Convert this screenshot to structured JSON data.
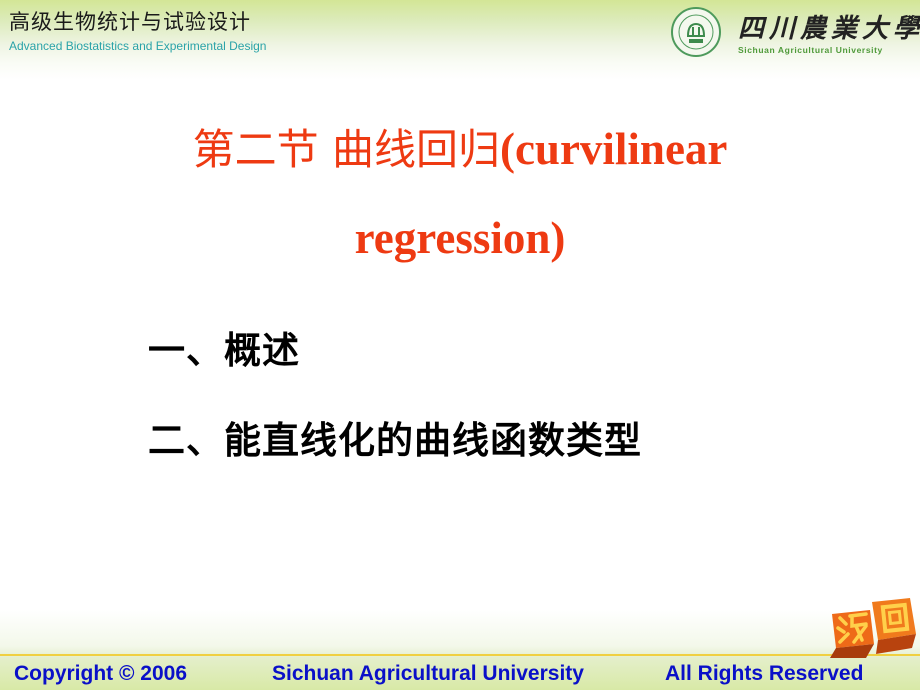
{
  "header": {
    "course_title_cn": "高级生物统计与试验设计",
    "course_title_en": "Advanced Biostatistics and Experimental Design",
    "logo": {
      "seal_icon": "university-seal-icon",
      "name_cn": "四川農業大學",
      "name_en": "Sichuan Agricultural University"
    }
  },
  "slide": {
    "title_cn": "第二节  曲线回归",
    "title_en_line1": "(curvilinear",
    "title_en_line2": "regression)",
    "outline": [
      {
        "label": "一、概述"
      },
      {
        "label": "二、能直线化的曲线函数类型"
      }
    ]
  },
  "nav": {
    "return_label": "返回",
    "return_icon": "return-3d-block-icon"
  },
  "footer": {
    "copyright": "Copyright © 2006",
    "university": "Sichuan Agricultural University",
    "rights": "All Rights Reserved"
  },
  "colors": {
    "title": "#ee3a12",
    "footer_text": "#0a10c8",
    "accent_green": "#d3e696",
    "rule": "#f0d040",
    "subtitle_teal": "#2aa3a8",
    "return_orange": "#e8661a"
  }
}
